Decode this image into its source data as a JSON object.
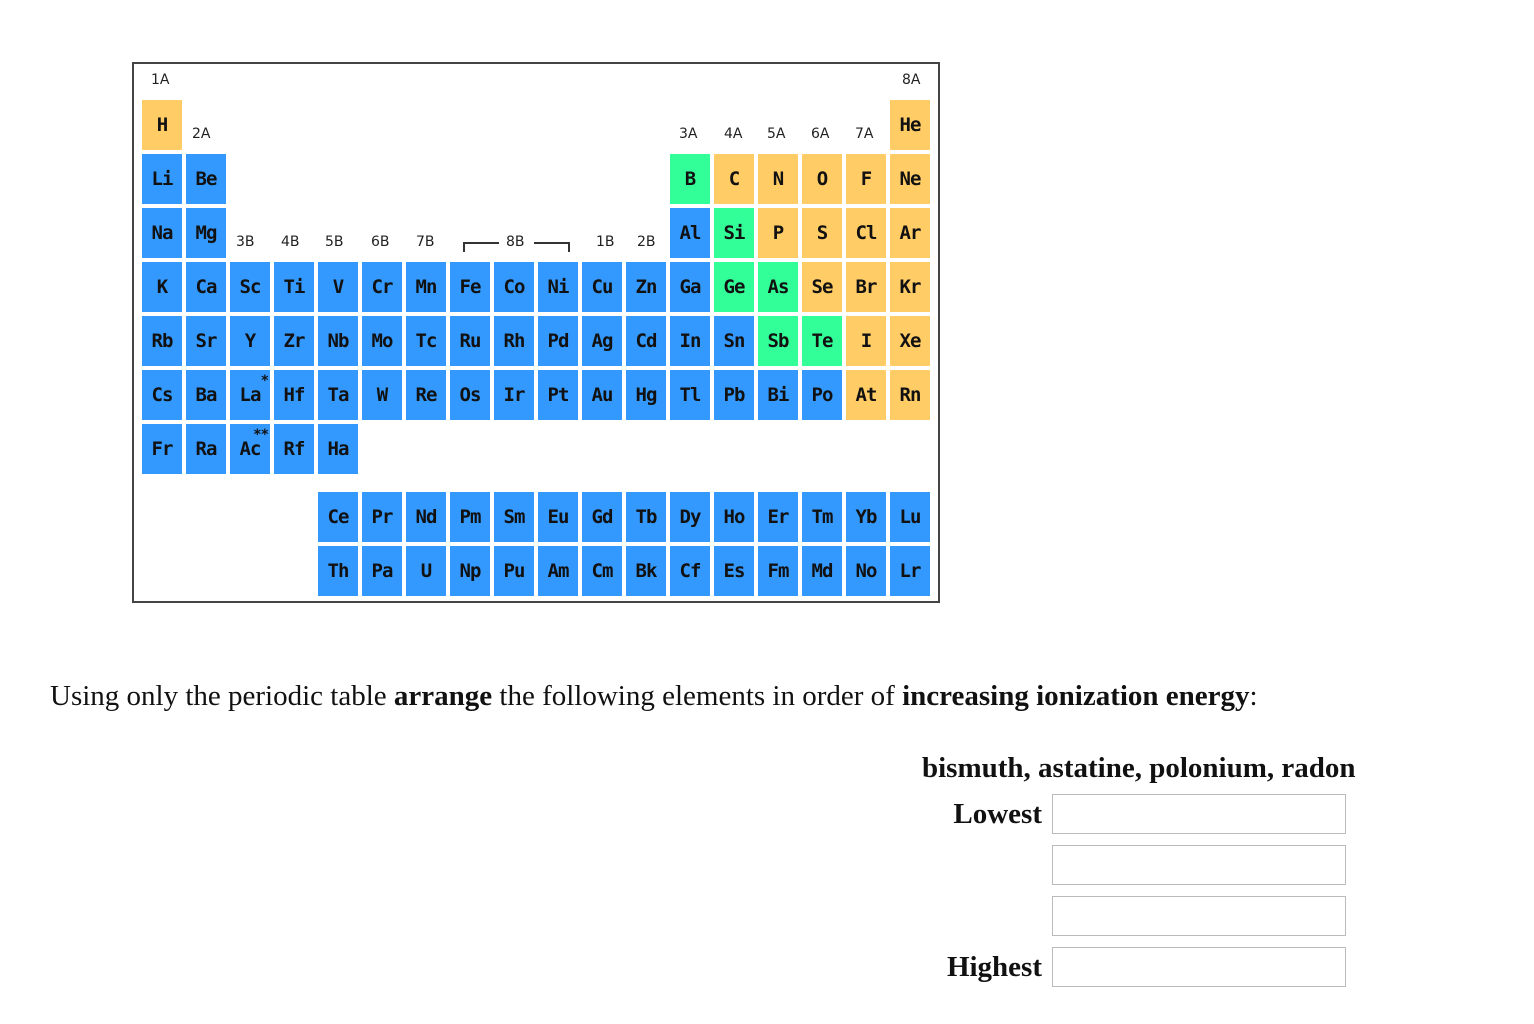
{
  "periodic_table": {
    "colors": {
      "metal": "#3399ff",
      "nonmetal": "#ffcc66",
      "metalloid": "#33ff99"
    },
    "group_labels": {
      "1A": "1A",
      "2A": "2A",
      "3B": "3B",
      "4B": "4B",
      "5B": "5B",
      "6B": "6B",
      "7B": "7B",
      "8B": "8B",
      "1B": "1B",
      "2B": "2B",
      "3A": "3A",
      "4A": "4A",
      "5A": "5A",
      "6A": "6A",
      "7A": "7A",
      "8A": "8A"
    },
    "elements": [
      {
        "symbol": "H",
        "row": 1,
        "col": 1,
        "type": "nonmetal"
      },
      {
        "symbol": "He",
        "row": 1,
        "col": 18,
        "type": "nonmetal"
      },
      {
        "symbol": "Li",
        "row": 2,
        "col": 1,
        "type": "metal"
      },
      {
        "symbol": "Be",
        "row": 2,
        "col": 2,
        "type": "metal"
      },
      {
        "symbol": "B",
        "row": 2,
        "col": 13,
        "type": "metalloid"
      },
      {
        "symbol": "C",
        "row": 2,
        "col": 14,
        "type": "nonmetal"
      },
      {
        "symbol": "N",
        "row": 2,
        "col": 15,
        "type": "nonmetal"
      },
      {
        "symbol": "O",
        "row": 2,
        "col": 16,
        "type": "nonmetal"
      },
      {
        "symbol": "F",
        "row": 2,
        "col": 17,
        "type": "nonmetal"
      },
      {
        "symbol": "Ne",
        "row": 2,
        "col": 18,
        "type": "nonmetal"
      },
      {
        "symbol": "Na",
        "row": 3,
        "col": 1,
        "type": "metal"
      },
      {
        "symbol": "Mg",
        "row": 3,
        "col": 2,
        "type": "metal"
      },
      {
        "symbol": "Al",
        "row": 3,
        "col": 13,
        "type": "metal"
      },
      {
        "symbol": "Si",
        "row": 3,
        "col": 14,
        "type": "metalloid"
      },
      {
        "symbol": "P",
        "row": 3,
        "col": 15,
        "type": "nonmetal"
      },
      {
        "symbol": "S",
        "row": 3,
        "col": 16,
        "type": "nonmetal"
      },
      {
        "symbol": "Cl",
        "row": 3,
        "col": 17,
        "type": "nonmetal"
      },
      {
        "symbol": "Ar",
        "row": 3,
        "col": 18,
        "type": "nonmetal"
      },
      {
        "symbol": "K",
        "row": 4,
        "col": 1,
        "type": "metal"
      },
      {
        "symbol": "Ca",
        "row": 4,
        "col": 2,
        "type": "metal"
      },
      {
        "symbol": "Sc",
        "row": 4,
        "col": 3,
        "type": "metal"
      },
      {
        "symbol": "Ti",
        "row": 4,
        "col": 4,
        "type": "metal"
      },
      {
        "symbol": "V",
        "row": 4,
        "col": 5,
        "type": "metal"
      },
      {
        "symbol": "Cr",
        "row": 4,
        "col": 6,
        "type": "metal"
      },
      {
        "symbol": "Mn",
        "row": 4,
        "col": 7,
        "type": "metal"
      },
      {
        "symbol": "Fe",
        "row": 4,
        "col": 8,
        "type": "metal"
      },
      {
        "symbol": "Co",
        "row": 4,
        "col": 9,
        "type": "metal"
      },
      {
        "symbol": "Ni",
        "row": 4,
        "col": 10,
        "type": "metal"
      },
      {
        "symbol": "Cu",
        "row": 4,
        "col": 11,
        "type": "metal"
      },
      {
        "symbol": "Zn",
        "row": 4,
        "col": 12,
        "type": "metal"
      },
      {
        "symbol": "Ga",
        "row": 4,
        "col": 13,
        "type": "metal"
      },
      {
        "symbol": "Ge",
        "row": 4,
        "col": 14,
        "type": "metalloid"
      },
      {
        "symbol": "As",
        "row": 4,
        "col": 15,
        "type": "metalloid"
      },
      {
        "symbol": "Se",
        "row": 4,
        "col": 16,
        "type": "nonmetal"
      },
      {
        "symbol": "Br",
        "row": 4,
        "col": 17,
        "type": "nonmetal"
      },
      {
        "symbol": "Kr",
        "row": 4,
        "col": 18,
        "type": "nonmetal"
      },
      {
        "symbol": "Rb",
        "row": 5,
        "col": 1,
        "type": "metal"
      },
      {
        "symbol": "Sr",
        "row": 5,
        "col": 2,
        "type": "metal"
      },
      {
        "symbol": "Y",
        "row": 5,
        "col": 3,
        "type": "metal"
      },
      {
        "symbol": "Zr",
        "row": 5,
        "col": 4,
        "type": "metal"
      },
      {
        "symbol": "Nb",
        "row": 5,
        "col": 5,
        "type": "metal"
      },
      {
        "symbol": "Mo",
        "row": 5,
        "col": 6,
        "type": "metal"
      },
      {
        "symbol": "Tc",
        "row": 5,
        "col": 7,
        "type": "metal"
      },
      {
        "symbol": "Ru",
        "row": 5,
        "col": 8,
        "type": "metal"
      },
      {
        "symbol": "Rh",
        "row": 5,
        "col": 9,
        "type": "metal"
      },
      {
        "symbol": "Pd",
        "row": 5,
        "col": 10,
        "type": "metal"
      },
      {
        "symbol": "Ag",
        "row": 5,
        "col": 11,
        "type": "metal"
      },
      {
        "symbol": "Cd",
        "row": 5,
        "col": 12,
        "type": "metal"
      },
      {
        "symbol": "In",
        "row": 5,
        "col": 13,
        "type": "metal"
      },
      {
        "symbol": "Sn",
        "row": 5,
        "col": 14,
        "type": "metal"
      },
      {
        "symbol": "Sb",
        "row": 5,
        "col": 15,
        "type": "metalloid"
      },
      {
        "symbol": "Te",
        "row": 5,
        "col": 16,
        "type": "metalloid"
      },
      {
        "symbol": "I",
        "row": 5,
        "col": 17,
        "type": "nonmetal"
      },
      {
        "symbol": "Xe",
        "row": 5,
        "col": 18,
        "type": "nonmetal"
      },
      {
        "symbol": "Cs",
        "row": 6,
        "col": 1,
        "type": "metal"
      },
      {
        "symbol": "Ba",
        "row": 6,
        "col": 2,
        "type": "metal"
      },
      {
        "symbol": "La",
        "row": 6,
        "col": 3,
        "type": "metal",
        "mark": "*"
      },
      {
        "symbol": "Hf",
        "row": 6,
        "col": 4,
        "type": "metal"
      },
      {
        "symbol": "Ta",
        "row": 6,
        "col": 5,
        "type": "metal"
      },
      {
        "symbol": "W",
        "row": 6,
        "col": 6,
        "type": "metal"
      },
      {
        "symbol": "Re",
        "row": 6,
        "col": 7,
        "type": "metal"
      },
      {
        "symbol": "Os",
        "row": 6,
        "col": 8,
        "type": "metal"
      },
      {
        "symbol": "Ir",
        "row": 6,
        "col": 9,
        "type": "metal"
      },
      {
        "symbol": "Pt",
        "row": 6,
        "col": 10,
        "type": "metal"
      },
      {
        "symbol": "Au",
        "row": 6,
        "col": 11,
        "type": "metal"
      },
      {
        "symbol": "Hg",
        "row": 6,
        "col": 12,
        "type": "metal"
      },
      {
        "symbol": "Tl",
        "row": 6,
        "col": 13,
        "type": "metal"
      },
      {
        "symbol": "Pb",
        "row": 6,
        "col": 14,
        "type": "metal"
      },
      {
        "symbol": "Bi",
        "row": 6,
        "col": 15,
        "type": "metal"
      },
      {
        "symbol": "Po",
        "row": 6,
        "col": 16,
        "type": "metal"
      },
      {
        "symbol": "At",
        "row": 6,
        "col": 17,
        "type": "nonmetal"
      },
      {
        "symbol": "Rn",
        "row": 6,
        "col": 18,
        "type": "nonmetal"
      },
      {
        "symbol": "Fr",
        "row": 7,
        "col": 1,
        "type": "metal"
      },
      {
        "symbol": "Ra",
        "row": 7,
        "col": 2,
        "type": "metal"
      },
      {
        "symbol": "Ac",
        "row": 7,
        "col": 3,
        "type": "metal",
        "mark": "**"
      },
      {
        "symbol": "Rf",
        "row": 7,
        "col": 4,
        "type": "metal"
      },
      {
        "symbol": "Ha",
        "row": 7,
        "col": 5,
        "type": "metal"
      },
      {
        "symbol": "Ce",
        "row": 8,
        "col": 5,
        "type": "metal"
      },
      {
        "symbol": "Pr",
        "row": 8,
        "col": 6,
        "type": "metal"
      },
      {
        "symbol": "Nd",
        "row": 8,
        "col": 7,
        "type": "metal"
      },
      {
        "symbol": "Pm",
        "row": 8,
        "col": 8,
        "type": "metal"
      },
      {
        "symbol": "Sm",
        "row": 8,
        "col": 9,
        "type": "metal"
      },
      {
        "symbol": "Eu",
        "row": 8,
        "col": 10,
        "type": "metal"
      },
      {
        "symbol": "Gd",
        "row": 8,
        "col": 11,
        "type": "metal"
      },
      {
        "symbol": "Tb",
        "row": 8,
        "col": 12,
        "type": "metal"
      },
      {
        "symbol": "Dy",
        "row": 8,
        "col": 13,
        "type": "metal"
      },
      {
        "symbol": "Ho",
        "row": 8,
        "col": 14,
        "type": "metal"
      },
      {
        "symbol": "Er",
        "row": 8,
        "col": 15,
        "type": "metal"
      },
      {
        "symbol": "Tm",
        "row": 8,
        "col": 16,
        "type": "metal"
      },
      {
        "symbol": "Yb",
        "row": 8,
        "col": 17,
        "type": "metal"
      },
      {
        "symbol": "Lu",
        "row": 8,
        "col": 18,
        "type": "metal"
      },
      {
        "symbol": "Th",
        "row": 9,
        "col": 5,
        "type": "metal"
      },
      {
        "symbol": "Pa",
        "row": 9,
        "col": 6,
        "type": "metal"
      },
      {
        "symbol": "U",
        "row": 9,
        "col": 7,
        "type": "metal"
      },
      {
        "symbol": "Np",
        "row": 9,
        "col": 8,
        "type": "metal"
      },
      {
        "symbol": "Pu",
        "row": 9,
        "col": 9,
        "type": "metal"
      },
      {
        "symbol": "Am",
        "row": 9,
        "col": 10,
        "type": "metal"
      },
      {
        "symbol": "Cm",
        "row": 9,
        "col": 11,
        "type": "metal"
      },
      {
        "symbol": "Bk",
        "row": 9,
        "col": 12,
        "type": "metal"
      },
      {
        "symbol": "Cf",
        "row": 9,
        "col": 13,
        "type": "metal"
      },
      {
        "symbol": "Es",
        "row": 9,
        "col": 14,
        "type": "metal"
      },
      {
        "symbol": "Fm",
        "row": 9,
        "col": 15,
        "type": "metal"
      },
      {
        "symbol": "Md",
        "row": 9,
        "col": 16,
        "type": "metal"
      },
      {
        "symbol": "No",
        "row": 9,
        "col": 17,
        "type": "metal"
      },
      {
        "symbol": "Lr",
        "row": 9,
        "col": 18,
        "type": "metal"
      }
    ]
  },
  "question": {
    "part1": "Using only the periodic table ",
    "bold1": "arrange",
    "part2": " the following elements in order of ",
    "bold2": "increasing ionization energy",
    "part3": ":"
  },
  "elements_list": "bismuth, astatine, polonium, radon",
  "ranking": {
    "lowest_label": "Lowest",
    "highest_label": "Highest",
    "answers": [
      "",
      "",
      "",
      ""
    ]
  }
}
